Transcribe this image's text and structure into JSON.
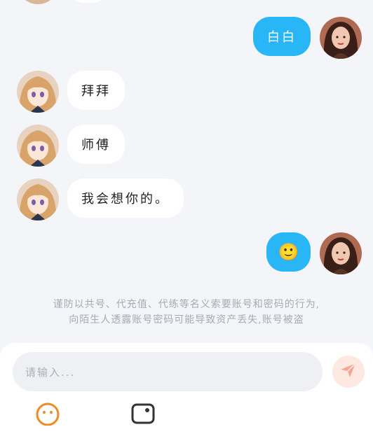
{
  "messages": [
    {
      "side": "in",
      "text": "拜拜"
    },
    {
      "side": "in",
      "text": "师傅"
    },
    {
      "side": "in",
      "text": "我会想你的。"
    },
    {
      "side": "out",
      "text": "白白"
    },
    {
      "side": "out",
      "emoji": "🙂"
    }
  ],
  "notice": {
    "line1": "谨防以共号、代充值、代练等名义索要账号和密码的行为,",
    "line2": "向陌生人透露账号密码可能导致资产丢失,账号被盗"
  },
  "composer": {
    "placeholder": "请输入...",
    "send_icon": "send-icon"
  },
  "toolbar": {
    "icons": [
      "emoji-icon",
      "image-icon"
    ]
  },
  "colors": {
    "out_bubble": "#29b6f6",
    "in_bubble": "#ffffff",
    "send_button_bg": "#fde8e2",
    "send_icon": "#f5a58e"
  }
}
